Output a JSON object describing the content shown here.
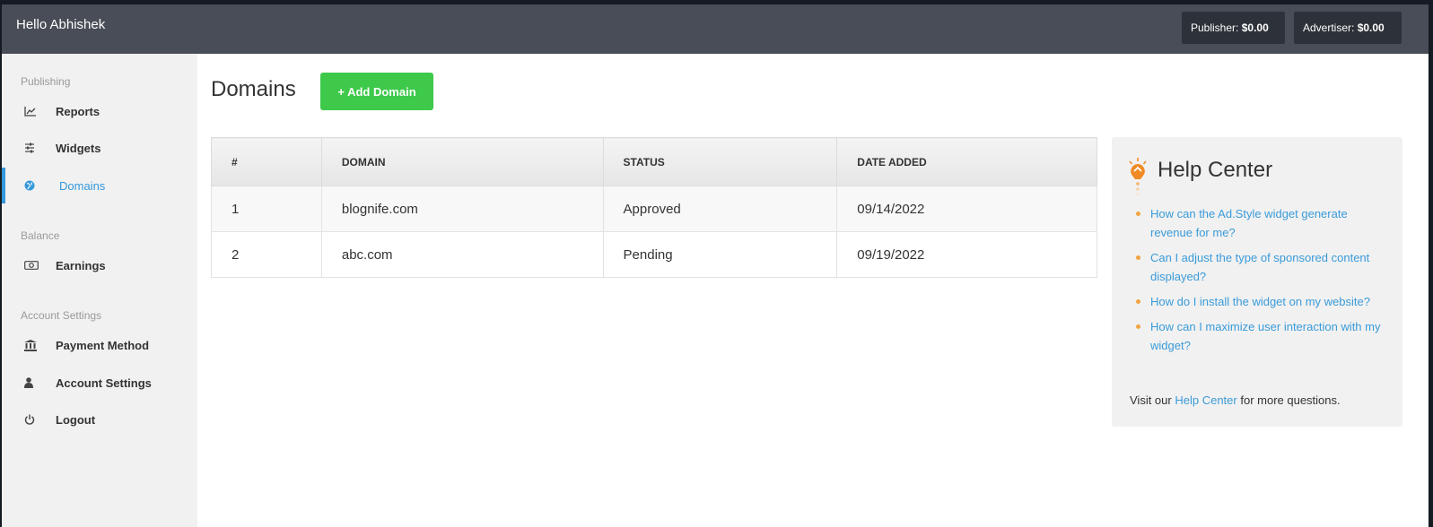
{
  "header": {
    "greeting": "Hello Abhishek",
    "publisher_label": "Publisher:",
    "publisher_value": "$0.00",
    "advertiser_label": "Advertiser:",
    "advertiser_value": "$0.00"
  },
  "sidebar": {
    "sections": [
      {
        "title": "Publishing",
        "items": [
          {
            "label": "Reports",
            "icon": "chart-line-icon"
          },
          {
            "label": "Widgets",
            "icon": "sliders-icon"
          },
          {
            "label": "Domains",
            "icon": "globe-icon",
            "active": true
          }
        ]
      },
      {
        "title": "Balance",
        "items": [
          {
            "label": "Earnings",
            "icon": "money-icon"
          }
        ]
      },
      {
        "title": "Account Settings",
        "items": [
          {
            "label": "Payment Method",
            "icon": "bank-icon"
          },
          {
            "label": "Account Settings",
            "icon": "user-icon"
          },
          {
            "label": "Logout",
            "icon": "power-icon"
          }
        ]
      }
    ]
  },
  "main": {
    "title": "Domains",
    "add_button": "+ Add Domain",
    "table": {
      "columns": [
        "#",
        "DOMAIN",
        "STATUS",
        "DATE ADDED"
      ],
      "rows": [
        [
          "1",
          "blognife.com",
          "Approved",
          "09/14/2022"
        ],
        [
          "2",
          "abc.com",
          "Pending",
          "09/19/2022"
        ]
      ]
    }
  },
  "help": {
    "title": "Help Center",
    "links": [
      "How can the Ad.Style widget generate revenue for me?",
      "Can I adjust the type of sponsored content displayed?",
      "How do I install the widget on my website?",
      "How can I maximize user interaction with my widget?"
    ],
    "footer_prefix": "Visit our",
    "footer_link": "Help Center",
    "footer_suffix": "for more questions."
  },
  "colors": {
    "accent": "#3498db",
    "add_button": "#3ec94a",
    "topbar": "#484d57",
    "help_bullet": "#f2a441",
    "help_icon": "#f08a24"
  }
}
